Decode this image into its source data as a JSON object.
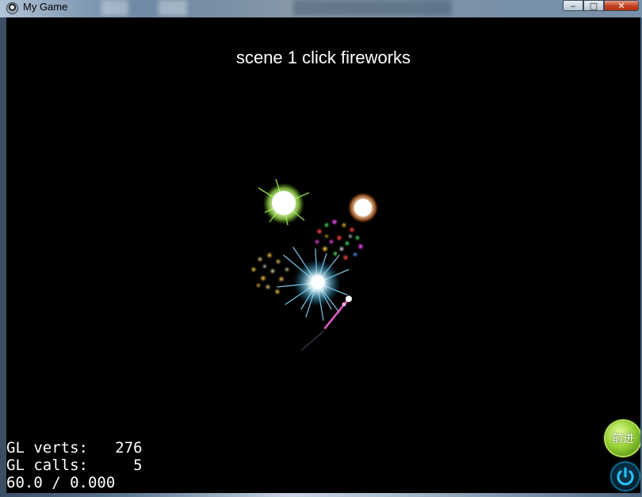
{
  "window": {
    "title": "My Game",
    "controls": {
      "minimize": "‒",
      "maximize": "□",
      "close": "✕"
    }
  },
  "scene": {
    "title": "scene 1 click fireworks"
  },
  "stats": {
    "verts_label": "GL verts:",
    "verts_value": "276",
    "calls_label": "GL calls:",
    "calls_value": "5",
    "fps": "60.0 / 0.000"
  },
  "buttons": {
    "forward_label": "前进",
    "power_icon": "power-icon"
  },
  "fireworks": [
    {
      "name": "green-firework",
      "color": "#b8ff6a"
    },
    {
      "name": "orange-firework",
      "color": "#ffd39a"
    },
    {
      "name": "multicolor-firework",
      "colors": [
        "#ff4040",
        "#40ff60",
        "#ff40ff",
        "#ffcc30"
      ]
    },
    {
      "name": "gold-firework",
      "color": "#ffc640"
    },
    {
      "name": "cyan-firework",
      "color": "#9fe6ff"
    },
    {
      "name": "pink-rocket",
      "color": "#ff66dd"
    }
  ]
}
